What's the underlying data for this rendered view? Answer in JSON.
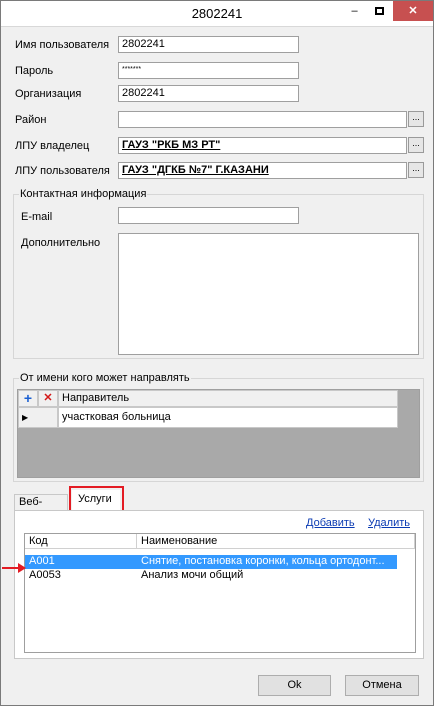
{
  "window": {
    "title": "2802241",
    "minimize": "–",
    "close": "✕"
  },
  "fields": {
    "username_label": "Имя пользователя",
    "username_value": "2802241",
    "password_label": "Пароль",
    "password_value": "*******",
    "org_label": "Организация",
    "org_value": "2802241",
    "district_label": "Район",
    "district_value": "",
    "lpu_owner_label": "ЛПУ владелец",
    "lpu_owner_value": "ГАУЗ \"РКБ МЗ РТ\"",
    "lpu_user_label": "ЛПУ пользователя",
    "lpu_user_value": "ГАУЗ \"ДГКБ №7\" Г.КАЗАНИ",
    "ellipsis": "..."
  },
  "contact": {
    "group_title": "Контактная информация",
    "email_label": "E-mail",
    "email_value": "",
    "extra_label": "Дополнительно",
    "extra_value": ""
  },
  "send_on_behalf": {
    "group_title": "От имени кого может направлять",
    "add_icon": "+",
    "delete_icon": "✕",
    "column": "Направитель",
    "row_marker": "▶",
    "rows": [
      "участковая больница"
    ]
  },
  "tabs": {
    "web_roles": "Веб-роли",
    "services": "Услуги"
  },
  "services": {
    "add_link": "Добавить",
    "delete_link": "Удалить",
    "columns": [
      "Код",
      "Наименование"
    ],
    "rows": [
      {
        "code": "A001",
        "name": "Снятие, постановка коронки, кольца ортодонт..."
      },
      {
        "code": "A0053",
        "name": "Анализ мочи общий"
      }
    ]
  },
  "buttons": {
    "ok": "Ok",
    "cancel": "Отмена"
  },
  "colors": {
    "selection": "#3399ff",
    "highlight": "#e31b23",
    "link": "#0b3bb3"
  }
}
